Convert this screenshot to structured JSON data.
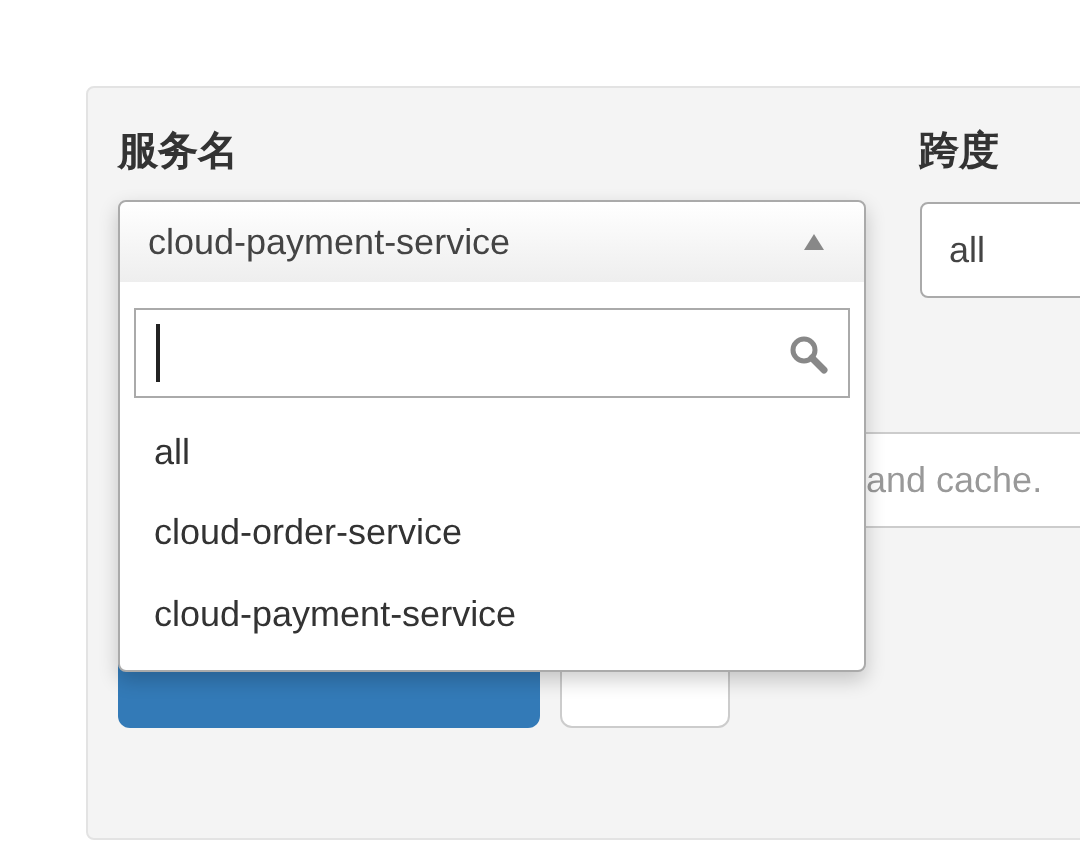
{
  "service": {
    "label": "服务名",
    "value": "cloud-payment-service",
    "expanded": true,
    "options": [
      {
        "label": "all"
      },
      {
        "label": "cloud-order-service"
      },
      {
        "label": "cloud-payment-service"
      }
    ]
  },
  "span": {
    "label": "跨度",
    "value": "all"
  },
  "query": {
    "placeholder": "and cache."
  }
}
